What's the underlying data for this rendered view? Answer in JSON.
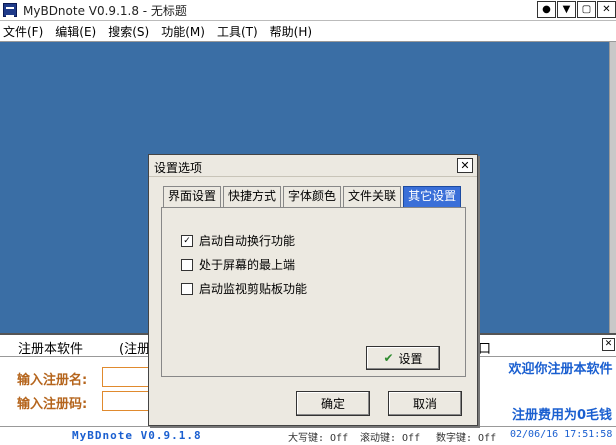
{
  "window": {
    "title": "MyBDnote V0.9.1.8 - 无标题",
    "buttons": [
      "●",
      "▼",
      "▢",
      "✕"
    ]
  },
  "menu": [
    "文件(F)",
    "编辑(E)",
    "搜索(S)",
    "功能(M)",
    "工具(T)",
    "帮助(H)"
  ],
  "register_panel": {
    "title": "注册本软件",
    "title2": "(注册",
    "title3": "口",
    "close": "✕",
    "name_label": "输入注册名:",
    "code_label": "输入注册码:",
    "welcome": "欢迎你注册本软件",
    "fee": "注册费用为0毛钱"
  },
  "statusbar": {
    "version": "MyBDnote V0.9.1.8",
    "caps": "大写键: Off",
    "scroll": "滚动键: Off",
    "num": "数字键: Off",
    "datetime": "02/06/16 17:51:58"
  },
  "dialog": {
    "title": "设置选项",
    "close": "✕",
    "tabs": [
      "界面设置",
      "快捷方式",
      "字体颜色",
      "文件关联",
      "其它设置"
    ],
    "active_tab": 4,
    "options": [
      {
        "label": "启动自动换行功能",
        "checked": true
      },
      {
        "label": "处于屏幕的最上端",
        "checked": false
      },
      {
        "label": "启动监视剪贴板功能",
        "checked": false
      }
    ],
    "set_button": "设置",
    "ok_button": "确定",
    "cancel_button": "取消"
  },
  "colors": {
    "editor_bg": "#3a6ea5",
    "active_tab": "#3a6fd8",
    "label_orange": "#b5651d",
    "accent_blue": "#1a5fd0"
  }
}
